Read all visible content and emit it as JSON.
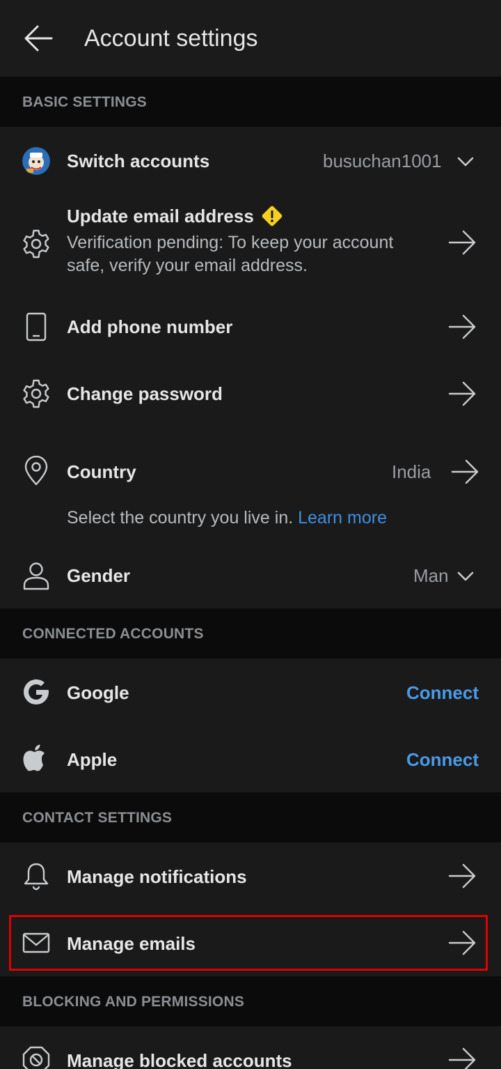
{
  "header": {
    "title": "Account settings"
  },
  "sections": {
    "basic": "BASIC SETTINGS",
    "connected": "CONNECTED ACCOUNTS",
    "contact": "CONTACT SETTINGS",
    "blocking": "BLOCKING AND PERMISSIONS"
  },
  "basic": {
    "switch_accounts": {
      "label": "Switch accounts",
      "value": "busuchan1001"
    },
    "update_email": {
      "label": "Update email address",
      "sub": "Verification pending: To keep your account safe, verify your email address."
    },
    "phone": {
      "label": "Add phone number"
    },
    "password": {
      "label": "Change password"
    },
    "country": {
      "label": "Country",
      "value": "India",
      "hint": "Select the country you live in.",
      "link": "Learn more"
    },
    "gender": {
      "label": "Gender",
      "value": "Man"
    }
  },
  "connected": {
    "google": {
      "label": "Google",
      "action": "Connect"
    },
    "apple": {
      "label": "Apple",
      "action": "Connect"
    }
  },
  "contact": {
    "notifications": {
      "label": "Manage notifications"
    },
    "emails": {
      "label": "Manage emails"
    }
  },
  "blocking": {
    "blocked": {
      "label": "Manage blocked accounts"
    }
  },
  "colors": {
    "background": "#121212",
    "panel": "#1a1a1b",
    "link": "#4a9ae6",
    "warning": "#f5d020",
    "highlight": "#e00000"
  }
}
